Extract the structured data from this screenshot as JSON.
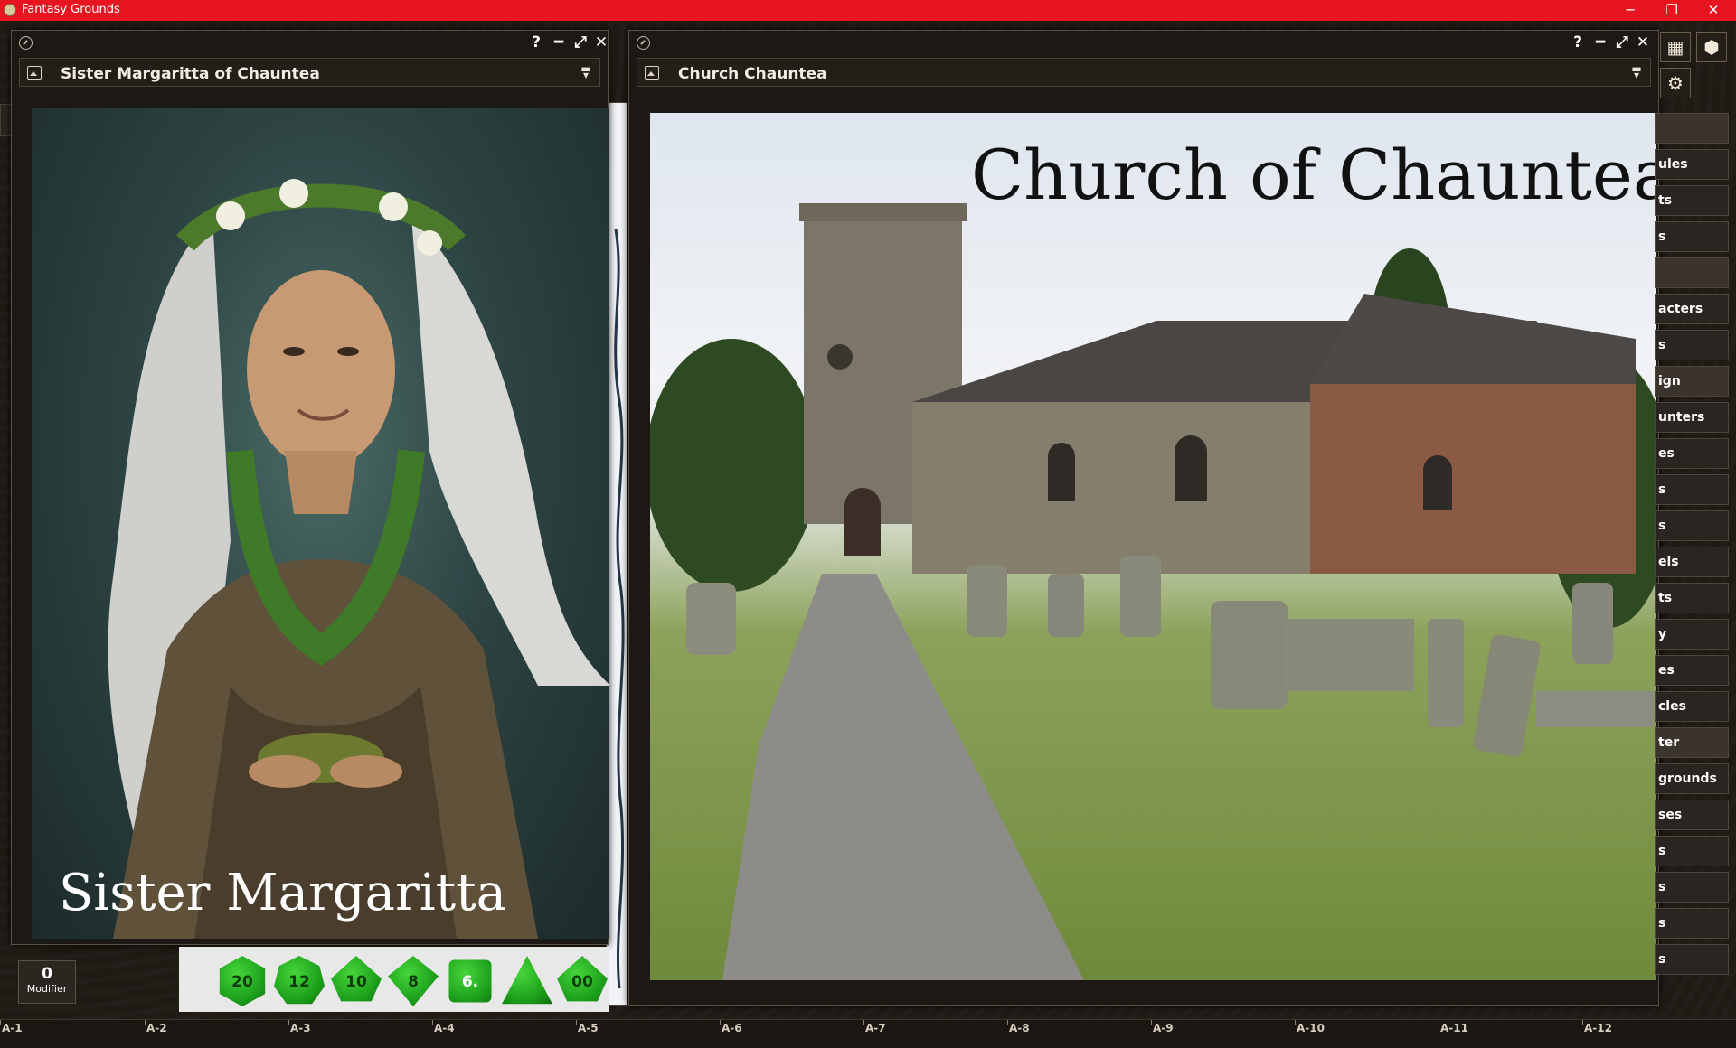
{
  "app": {
    "title": "Fantasy Grounds"
  },
  "window_controls": {
    "minimize": "─",
    "restore": "❐",
    "close": "✕"
  },
  "left_window": {
    "title": "Sister Margaritta of Chauntea",
    "image_caption": "Sister Margaritta",
    "help": "?",
    "minimize": "━",
    "expand": "⤢",
    "close": "✕"
  },
  "right_window": {
    "title": "Church Chauntea",
    "image_caption": "Church of Chauntea",
    "help": "?",
    "minimize": "━",
    "expand": "⤢",
    "close": "✕"
  },
  "sidebar": {
    "items": [
      "",
      "ules",
      "ts",
      "s",
      "",
      "acters",
      "s",
      "ign",
      "unters",
      "es",
      "s",
      "s",
      "els",
      "ts",
      "y",
      "es",
      "cles",
      "ter",
      "grounds",
      "ses",
      "s",
      "s",
      "s",
      "s"
    ]
  },
  "modifier": {
    "value": "0",
    "label": "Modifier"
  },
  "dice": [
    {
      "name": "d20",
      "label": "20"
    },
    {
      "name": "d12",
      "label": "12"
    },
    {
      "name": "d10",
      "label": "10"
    },
    {
      "name": "d8",
      "label": "8"
    },
    {
      "name": "d6",
      "label": "6."
    },
    {
      "name": "d4",
      "label": ""
    },
    {
      "name": "d100",
      "label": "00"
    }
  ],
  "grid_labels": [
    "A-1",
    "A-2",
    "A-3",
    "A-4",
    "A-5",
    "A-6",
    "A-7",
    "A-8",
    "A-9",
    "A-10",
    "A-11",
    "A-12"
  ],
  "colors": {
    "titlebar": "#e8141f",
    "dice": "#2bb52a",
    "panel": "#1c1813"
  }
}
